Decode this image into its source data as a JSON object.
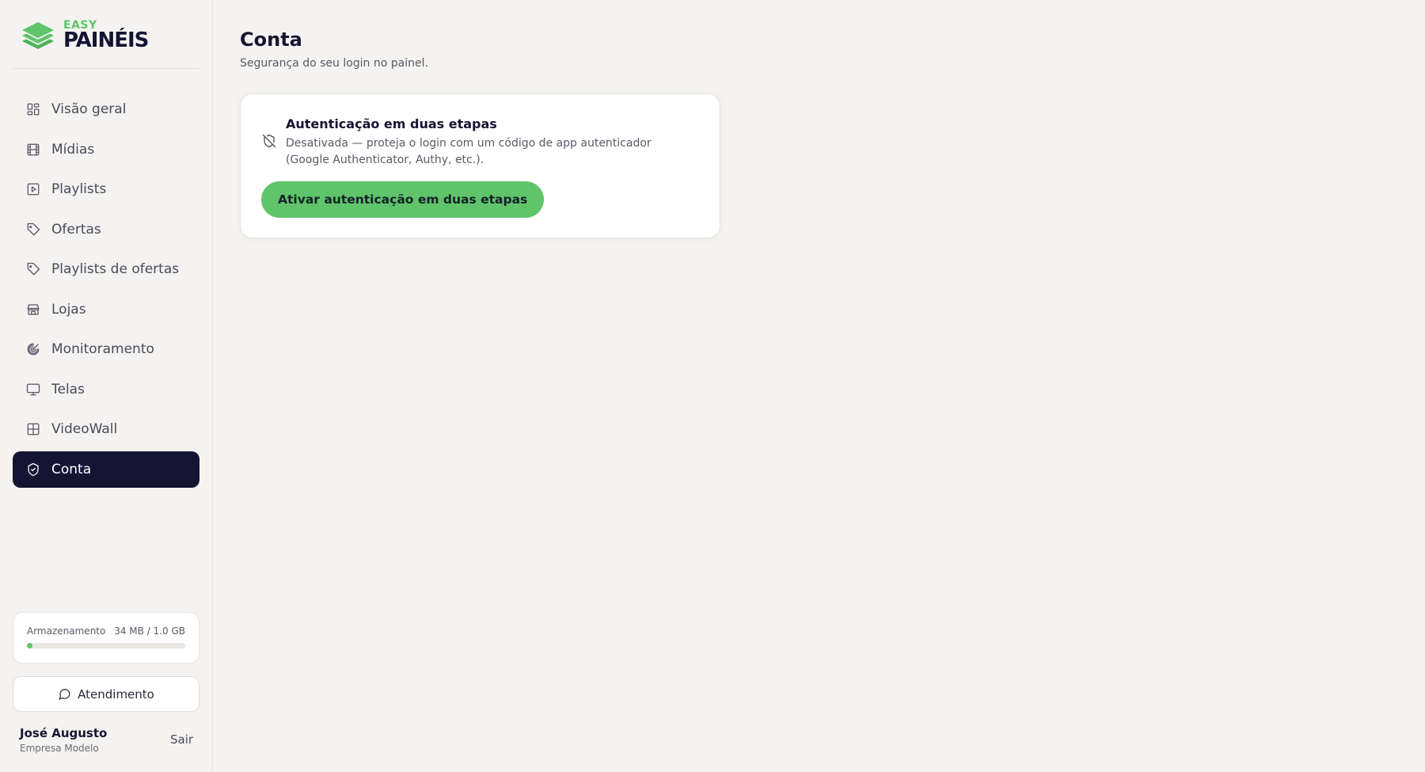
{
  "brand": {
    "small": "EASY",
    "big": "PAINÉIS",
    "accent": "#5fc46a",
    "dark": "#161433"
  },
  "sidebar": {
    "items": [
      {
        "label": "Visão geral",
        "icon": "grid-icon"
      },
      {
        "label": "Mídias",
        "icon": "film-icon"
      },
      {
        "label": "Playlists",
        "icon": "play-square-icon"
      },
      {
        "label": "Ofertas",
        "icon": "tag-icon"
      },
      {
        "label": "Playlists de ofertas",
        "icon": "tag-icon"
      },
      {
        "label": "Lojas",
        "icon": "store-icon"
      },
      {
        "label": "Monitoramento",
        "icon": "radar-icon"
      },
      {
        "label": "Telas",
        "icon": "monitor-icon"
      },
      {
        "label": "VideoWall",
        "icon": "grid-2x2-icon"
      },
      {
        "label": "Conta",
        "icon": "shield-check-icon",
        "active": true
      }
    ]
  },
  "storage": {
    "label": "Armazenamento",
    "usage": "34 MB / 1.0 GB",
    "fraction": 0.033
  },
  "support": {
    "label": "Atendimento",
    "icon": "message-circle-icon"
  },
  "user": {
    "name": "José Augusto",
    "company": "Empresa Modelo",
    "logout": "Sair"
  },
  "page": {
    "title": "Conta",
    "subtitle": "Segurança do seu login no painel."
  },
  "two_factor": {
    "icon": "shield-off-icon",
    "title": "Autenticação em duas etapas",
    "description": "Desativada — proteja o login com um código de app autenticador (Google Authenticator, Authy, etc.).",
    "button": "Ativar autenticação em duas etapas"
  }
}
